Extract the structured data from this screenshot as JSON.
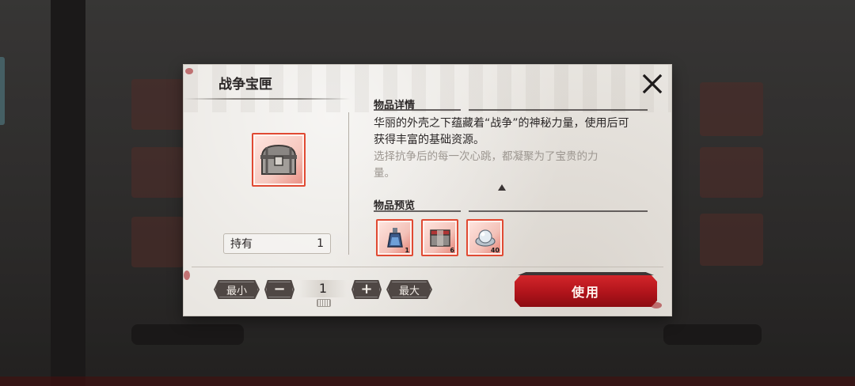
{
  "dialog": {
    "title": "战争宝匣",
    "close_icon": "close-x-icon",
    "item_icon": "treasure-chest-icon",
    "holding": {
      "label": "持有",
      "count": "1"
    },
    "details": {
      "heading": "物品详情",
      "description": "华丽的外壳之下蕴藏着“战争”的神秘力量，使用后可获得丰富的基础资源。",
      "flavor": "选择抗争后的每一次心跳，都凝聚为了宝贵的力量。"
    },
    "preview": {
      "heading": "物品预览",
      "items": [
        {
          "icon": "blue-potion-icon",
          "count": "1"
        },
        {
          "icon": "supply-crate-icon",
          "count": "6"
        },
        {
          "icon": "silver-orb-icon",
          "count": "40"
        }
      ]
    },
    "quantity": {
      "min_label": "最小",
      "minus_icon": "minus-icon",
      "value": "1",
      "plus_icon": "plus-icon",
      "max_label": "最大",
      "keyboard_icon": "keyboard-icon"
    },
    "use_button": "使用"
  },
  "colors": {
    "accent_red": "#c41a20",
    "rarity_border": "#e04a33",
    "dialog_bg": "#e9e6e1",
    "button_dark": "#4f4744"
  }
}
